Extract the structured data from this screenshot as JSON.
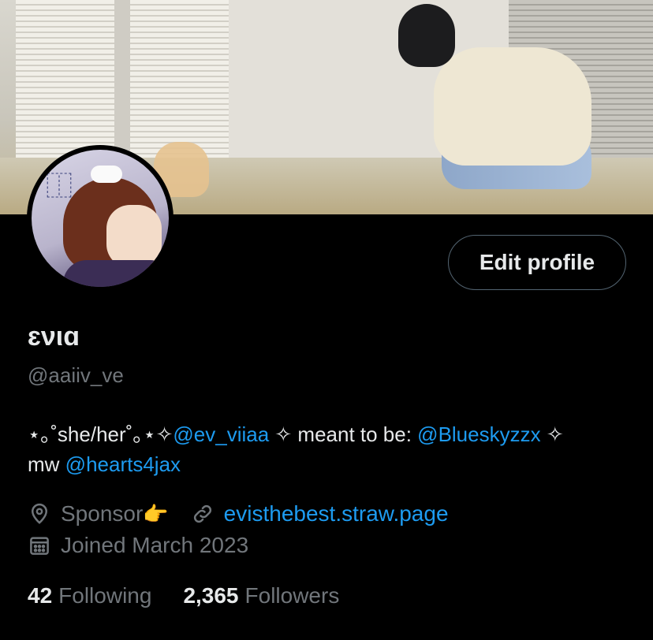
{
  "profile": {
    "display_name": "ɛνιɑ",
    "handle": "@aaiiv_ve",
    "edit_button": "Edit profile",
    "bio": {
      "prefix": "⋆｡˚she/her˚｡⋆✧",
      "mention1": "@ev_viiaa",
      "mid": " ✧ meant to be: ",
      "mention2": "@Blueskyzzx",
      "suffix": " ✧",
      "line2_prefix": "mw ",
      "mention3": "@hearts4jax"
    },
    "location": "Sponsor",
    "location_emoji": "👉",
    "website": "evisthebest.straw.page",
    "joined": "Joined March 2023"
  },
  "stats": {
    "following_count": "42",
    "following_label": "Following",
    "followers_count": "2,365",
    "followers_label": "Followers"
  },
  "icons": {
    "location": "location-pin-icon",
    "link": "link-icon",
    "calendar": "calendar-icon"
  },
  "colors": {
    "background": "#000000",
    "text_primary": "#e7e9ea",
    "text_secondary": "#71767b",
    "link": "#1d9bf0",
    "border": "#536471"
  }
}
